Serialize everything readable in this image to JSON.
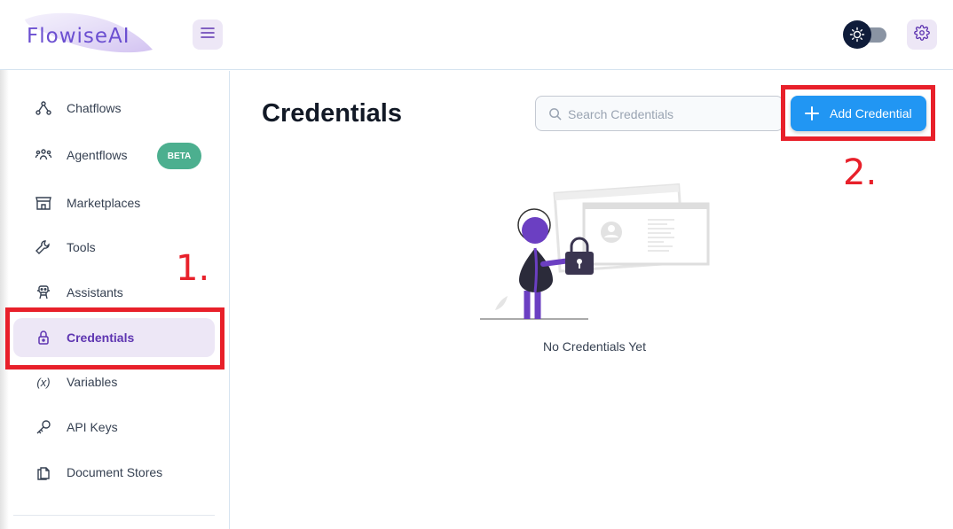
{
  "header": {
    "logo_text": "FlowiseAI",
    "menu_icon": "hamburger-icon",
    "theme_toggle_icon": "sun-icon",
    "settings_icon": "gear-icon"
  },
  "sidebar": {
    "items": [
      {
        "label": "Chatflows",
        "icon": "chatflow-icon"
      },
      {
        "label": "Agentflows",
        "icon": "agents-icon",
        "badge": "BETA"
      },
      {
        "label": "Marketplaces",
        "icon": "store-icon"
      },
      {
        "label": "Tools",
        "icon": "tool-icon"
      },
      {
        "label": "Assistants",
        "icon": "robot-icon"
      },
      {
        "label": "Credentials",
        "icon": "lock-icon",
        "active": true
      },
      {
        "label": "Variables",
        "icon": "variable-icon",
        "icon_text": "(x)"
      },
      {
        "label": "API Keys",
        "icon": "key-icon"
      },
      {
        "label": "Document Stores",
        "icon": "files-icon"
      }
    ]
  },
  "main": {
    "title": "Credentials",
    "search_placeholder": "Search Credentials",
    "add_button_label": "Add Credential",
    "empty_state_text": "No Credentials Yet"
  },
  "annotations": {
    "step1": "1.",
    "step2": "2."
  },
  "colors": {
    "accent_purple": "#5e35b1",
    "button_blue": "#2196f3",
    "annotation_red": "#e8202a",
    "beta_green": "#4caf8f"
  }
}
